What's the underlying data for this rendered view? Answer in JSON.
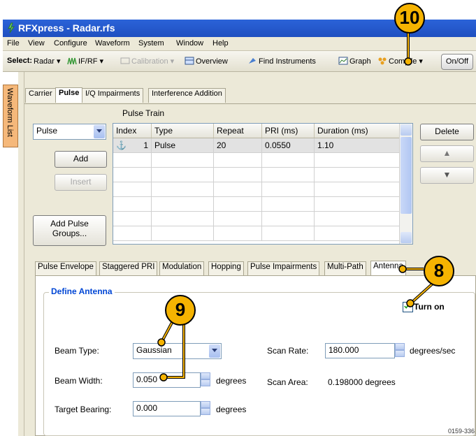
{
  "window": {
    "title": "RFXpress - Radar.rfs"
  },
  "menu": [
    "File",
    "View",
    "Configure",
    "Waveform",
    "System",
    "Window",
    "Help"
  ],
  "toolbar": {
    "select_label": "Select:",
    "select_value": "Radar",
    "if_rf": "IF/RF",
    "calibration": "Calibration",
    "overview": "Overview",
    "find_instruments": "Find Instruments",
    "graph": "Graph",
    "compile": "Compile",
    "onoff": "On/Off"
  },
  "side_tab": "Waveform List",
  "top_tabs": [
    "Carrier",
    "Pulse",
    "I/Q Impairments",
    "Interference Addition"
  ],
  "pulse_train": {
    "title": "Pulse Train",
    "type_select": "Pulse",
    "add": "Add",
    "insert": "Insert",
    "add_groups_line1": "Add Pulse",
    "add_groups_line2": "Groups...",
    "delete": "Delete",
    "columns": [
      "Index",
      "Type",
      "Repeat",
      "PRI (ms)",
      "Duration (ms)"
    ],
    "rows": [
      {
        "index": "1",
        "type": "Pulse",
        "repeat": "20",
        "pri": "0.0550",
        "duration": "1.10"
      }
    ]
  },
  "sub_tabs": [
    "Pulse Envelope",
    "Staggered PRI",
    "Modulation",
    "Hopping",
    "Pulse Impairments",
    "Multi-Path",
    "Antenna"
  ],
  "antenna": {
    "group_title": "Define Antenna",
    "turn_on": "Turn on",
    "turn_on_checked": true,
    "beam_type_label": "Beam Type:",
    "beam_type_value": "Gaussian",
    "beam_width_label": "Beam Width:",
    "beam_width_value": "0.050",
    "beam_width_unit": "degrees",
    "target_bearing_label": "Target Bearing:",
    "target_bearing_value": "0.000",
    "target_bearing_unit": "degrees",
    "scan_rate_label": "Scan Rate:",
    "scan_rate_value": "180.000",
    "scan_rate_unit": "degrees/sec",
    "scan_area_label": "Scan Area:",
    "scan_area_value": "0.198000 degrees"
  },
  "callouts": [
    "10",
    "8",
    "9"
  ],
  "figure_number": "0159-336",
  "colors": {
    "titlebar": "#2b63d8",
    "callout": "#f5b301",
    "group_title": "#0046d5",
    "side_tab": "#f5b87a"
  }
}
